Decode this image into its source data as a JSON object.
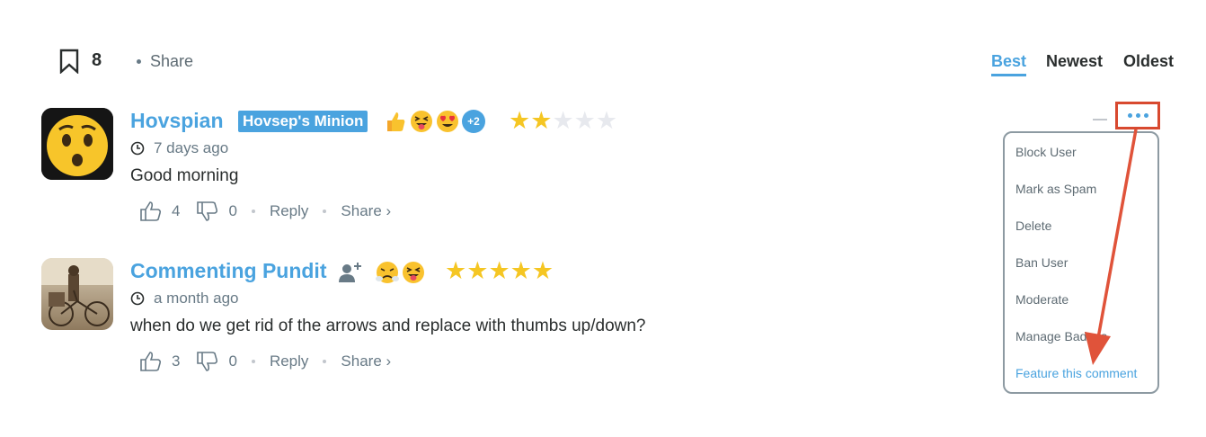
{
  "toolbar": {
    "bookmark_count": "8",
    "share_label": "Share",
    "sort_tabs": [
      "Best",
      "Newest",
      "Oldest"
    ],
    "active_sort": "Best"
  },
  "comments": [
    {
      "author": "Hovspian",
      "badge": "Hovsep's Minion",
      "reactions": [
        "thumbs-up",
        "squinting-tongue",
        "heart-eyes"
      ],
      "reactions_more": "+2",
      "rating": 2,
      "rating_max": 5,
      "time": "7 days ago",
      "text": "Good morning",
      "upvotes": "4",
      "downvotes": "0",
      "reply_label": "Reply",
      "share_label": "Share ›"
    },
    {
      "author": "Commenting Pundit",
      "reactions": [
        "steam-from-nose",
        "squinting-tongue"
      ],
      "rating": 5,
      "rating_max": 5,
      "time": "a month ago",
      "text": "when do we get rid of the arrows and replace with thumbs up/down?",
      "upvotes": "3",
      "downvotes": "0",
      "reply_label": "Reply",
      "share_label": "Share ›"
    }
  ],
  "menu": {
    "items": [
      "Block User",
      "Mark as Spam",
      "Delete",
      "Ban User",
      "Moderate",
      "Manage Badges",
      "Feature this comment"
    ]
  },
  "colors": {
    "accent": "#4aa3df",
    "highlight": "#d8492f",
    "star": "#f5c623"
  }
}
